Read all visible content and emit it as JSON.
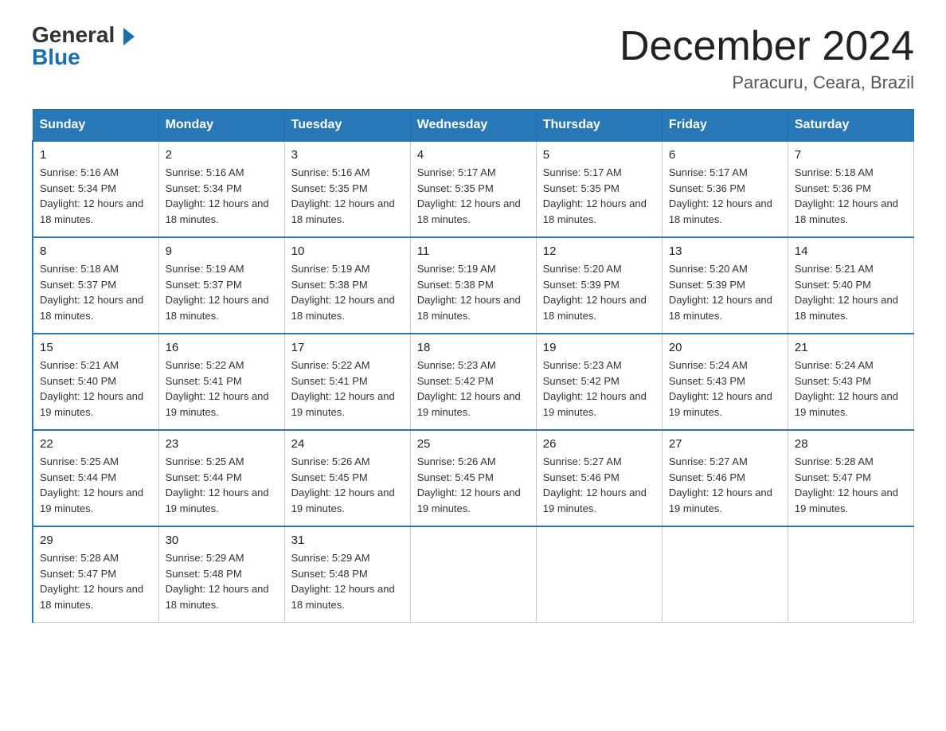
{
  "logo": {
    "general": "General",
    "blue": "Blue"
  },
  "header": {
    "title": "December 2024",
    "subtitle": "Paracuru, Ceara, Brazil"
  },
  "columns": [
    "Sunday",
    "Monday",
    "Tuesday",
    "Wednesday",
    "Thursday",
    "Friday",
    "Saturday"
  ],
  "weeks": [
    [
      {
        "day": "1",
        "sunrise": "5:16 AM",
        "sunset": "5:34 PM",
        "daylight": "12 hours and 18 minutes."
      },
      {
        "day": "2",
        "sunrise": "5:16 AM",
        "sunset": "5:34 PM",
        "daylight": "12 hours and 18 minutes."
      },
      {
        "day": "3",
        "sunrise": "5:16 AM",
        "sunset": "5:35 PM",
        "daylight": "12 hours and 18 minutes."
      },
      {
        "day": "4",
        "sunrise": "5:17 AM",
        "sunset": "5:35 PM",
        "daylight": "12 hours and 18 minutes."
      },
      {
        "day": "5",
        "sunrise": "5:17 AM",
        "sunset": "5:35 PM",
        "daylight": "12 hours and 18 minutes."
      },
      {
        "day": "6",
        "sunrise": "5:17 AM",
        "sunset": "5:36 PM",
        "daylight": "12 hours and 18 minutes."
      },
      {
        "day": "7",
        "sunrise": "5:18 AM",
        "sunset": "5:36 PM",
        "daylight": "12 hours and 18 minutes."
      }
    ],
    [
      {
        "day": "8",
        "sunrise": "5:18 AM",
        "sunset": "5:37 PM",
        "daylight": "12 hours and 18 minutes."
      },
      {
        "day": "9",
        "sunrise": "5:19 AM",
        "sunset": "5:37 PM",
        "daylight": "12 hours and 18 minutes."
      },
      {
        "day": "10",
        "sunrise": "5:19 AM",
        "sunset": "5:38 PM",
        "daylight": "12 hours and 18 minutes."
      },
      {
        "day": "11",
        "sunrise": "5:19 AM",
        "sunset": "5:38 PM",
        "daylight": "12 hours and 18 minutes."
      },
      {
        "day": "12",
        "sunrise": "5:20 AM",
        "sunset": "5:39 PM",
        "daylight": "12 hours and 18 minutes."
      },
      {
        "day": "13",
        "sunrise": "5:20 AM",
        "sunset": "5:39 PM",
        "daylight": "12 hours and 18 minutes."
      },
      {
        "day": "14",
        "sunrise": "5:21 AM",
        "sunset": "5:40 PM",
        "daylight": "12 hours and 18 minutes."
      }
    ],
    [
      {
        "day": "15",
        "sunrise": "5:21 AM",
        "sunset": "5:40 PM",
        "daylight": "12 hours and 19 minutes."
      },
      {
        "day": "16",
        "sunrise": "5:22 AM",
        "sunset": "5:41 PM",
        "daylight": "12 hours and 19 minutes."
      },
      {
        "day": "17",
        "sunrise": "5:22 AM",
        "sunset": "5:41 PM",
        "daylight": "12 hours and 19 minutes."
      },
      {
        "day": "18",
        "sunrise": "5:23 AM",
        "sunset": "5:42 PM",
        "daylight": "12 hours and 19 minutes."
      },
      {
        "day": "19",
        "sunrise": "5:23 AM",
        "sunset": "5:42 PM",
        "daylight": "12 hours and 19 minutes."
      },
      {
        "day": "20",
        "sunrise": "5:24 AM",
        "sunset": "5:43 PM",
        "daylight": "12 hours and 19 minutes."
      },
      {
        "day": "21",
        "sunrise": "5:24 AM",
        "sunset": "5:43 PM",
        "daylight": "12 hours and 19 minutes."
      }
    ],
    [
      {
        "day": "22",
        "sunrise": "5:25 AM",
        "sunset": "5:44 PM",
        "daylight": "12 hours and 19 minutes."
      },
      {
        "day": "23",
        "sunrise": "5:25 AM",
        "sunset": "5:44 PM",
        "daylight": "12 hours and 19 minutes."
      },
      {
        "day": "24",
        "sunrise": "5:26 AM",
        "sunset": "5:45 PM",
        "daylight": "12 hours and 19 minutes."
      },
      {
        "day": "25",
        "sunrise": "5:26 AM",
        "sunset": "5:45 PM",
        "daylight": "12 hours and 19 minutes."
      },
      {
        "day": "26",
        "sunrise": "5:27 AM",
        "sunset": "5:46 PM",
        "daylight": "12 hours and 19 minutes."
      },
      {
        "day": "27",
        "sunrise": "5:27 AM",
        "sunset": "5:46 PM",
        "daylight": "12 hours and 19 minutes."
      },
      {
        "day": "28",
        "sunrise": "5:28 AM",
        "sunset": "5:47 PM",
        "daylight": "12 hours and 19 minutes."
      }
    ],
    [
      {
        "day": "29",
        "sunrise": "5:28 AM",
        "sunset": "5:47 PM",
        "daylight": "12 hours and 18 minutes."
      },
      {
        "day": "30",
        "sunrise": "5:29 AM",
        "sunset": "5:48 PM",
        "daylight": "12 hours and 18 minutes."
      },
      {
        "day": "31",
        "sunrise": "5:29 AM",
        "sunset": "5:48 PM",
        "daylight": "12 hours and 18 minutes."
      },
      null,
      null,
      null,
      null
    ]
  ]
}
